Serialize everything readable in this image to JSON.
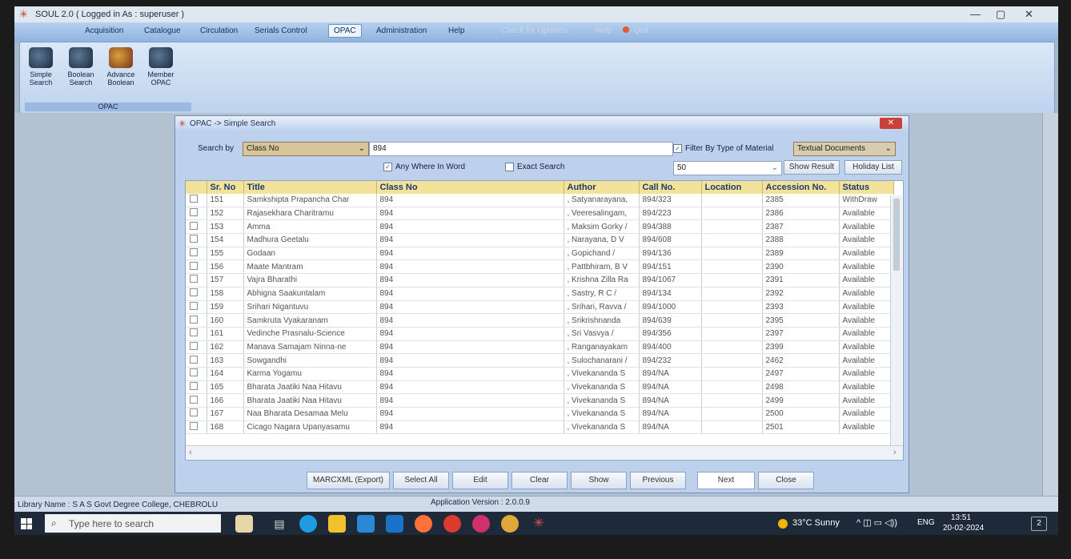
{
  "window": {
    "title": "SOUL 2.0  ( Logged in As : superuser )",
    "controls": [
      "—",
      "▢",
      "✕"
    ]
  },
  "menu": {
    "items": [
      "Acquisition",
      "Catalogue",
      "Circulation",
      "Serials Control",
      "OPAC",
      "Administration",
      "Help"
    ],
    "updates": "Check for Updates",
    "help": "Help",
    "quit": "Quit"
  },
  "ribbon": {
    "buttons": [
      {
        "label": "Simple Search",
        "icon": "magnifier-icon"
      },
      {
        "label": "Boolean Search",
        "icon": "monitor-search-icon"
      },
      {
        "label": "Advance Boolean",
        "icon": "books-icon"
      },
      {
        "label": "Member OPAC",
        "icon": "member-search-icon"
      }
    ],
    "group": "OPAC"
  },
  "dialog": {
    "title": "OPAC -> Simple Search",
    "search_by_label": "Search by",
    "search_by_value": "Class No",
    "search_value": "894",
    "any_where_label": "Any Where In Word",
    "exact_label": "Exact Search",
    "filter_label": "Filter By Type of Material",
    "material_value": "Textual Documents",
    "page_size": "50",
    "show_result": "Show Result",
    "holiday_list": "Holiday List",
    "columns": [
      "",
      "Sr. No",
      "Title",
      "Class No",
      "Author",
      "Call No.",
      "Location",
      "Accession No.",
      "Status"
    ],
    "rows": [
      [
        "151",
        "Samkshipta Prapancha Char",
        "894",
        ", Satyanarayana,",
        "894/323",
        "",
        "2385",
        "WithDraw"
      ],
      [
        "152",
        "Rajasekhara Charitramu",
        "894",
        ", Veeresalingam,",
        "894/223",
        "",
        "2386",
        "Available"
      ],
      [
        "153",
        "Amma",
        "894",
        ", Maksim Gorky /",
        "894/388",
        "",
        "2387",
        "Available"
      ],
      [
        "154",
        "Madhura Geetalu",
        "894",
        ", Narayana, D V",
        "894/608",
        "",
        "2388",
        "Available"
      ],
      [
        "155",
        "Godaan",
        "894",
        ", Gopichand /",
        "894/136",
        "",
        "2389",
        "Available"
      ],
      [
        "156",
        "Maate Mantram",
        "894",
        ", Pattbhiram, B V",
        "894/151",
        "",
        "2390",
        "Available"
      ],
      [
        "157",
        "Vajra Bharathi",
        "894",
        ", Krishna Zilla Ra",
        "894/1067",
        "",
        "2391",
        "Available"
      ],
      [
        "158",
        "Abhigna Saakuntalam",
        "894",
        ", Sastry, R C /",
        "894/134",
        "",
        "2392",
        "Available"
      ],
      [
        "159",
        "Srihari Nigantuvu",
        "894",
        ", Srihari, Ravva /",
        "894/1000",
        "",
        "2393",
        "Available"
      ],
      [
        "160",
        "Samkruta Vyakaranam",
        "894",
        ", Srikrishnanda",
        "894/639",
        "",
        "2395",
        "Available"
      ],
      [
        "161",
        "Vedinche Prasnalu-Science",
        "894",
        ", Sri Vasvya /",
        "894/356",
        "",
        "2397",
        "Available"
      ],
      [
        "162",
        "Manava Samajam Ninna-ne",
        "894",
        ", Ranganayakam",
        "894/400",
        "",
        "2399",
        "Available"
      ],
      [
        "163",
        "Sowgandhi",
        "894",
        ", Sulochanarani /",
        "894/232",
        "",
        "2462",
        "Available"
      ],
      [
        "164",
        "Karma Yogamu",
        "894",
        ", Vivekananda S",
        "894/NA",
        "",
        "2497",
        "Available"
      ],
      [
        "165",
        "Bharata Jaatiki Naa Hitavu",
        "894",
        ", Vivekananda S",
        "894/NA",
        "",
        "2498",
        "Available"
      ],
      [
        "166",
        "Bharata Jaatiki Naa Hitavu",
        "894",
        ", Vivekananda S",
        "894/NA",
        "",
        "2499",
        "Available"
      ],
      [
        "167",
        "Naa Bharata Desamaa Melu",
        "894",
        ", Vivekananda S",
        "894/NA",
        "",
        "2500",
        "Available"
      ],
      [
        "168",
        "Cicago Nagara Upanyasamu",
        "894",
        ", Vivekananda S",
        "894/NA",
        "",
        "2501",
        "Available"
      ]
    ],
    "buttons": [
      "MARCXML (Export)",
      "Select All",
      "Edit",
      "Clear",
      "Show",
      "Previous",
      "Next",
      "Close"
    ]
  },
  "status": {
    "library": "Library Name : S A S Govt Degree College, CHEBROLU",
    "version": "Application Version : 2.0.0.9"
  },
  "taskbar": {
    "search_placeholder": "Type here to search",
    "weather": "33°C  Sunny",
    "lang": "ENG",
    "time": "13:51",
    "date": "20-02-2024",
    "notifications": "2"
  },
  "colors": {
    "accent": "#f3e39a",
    "ribbon": "#bed3ee",
    "dialog": "#bdd1ec",
    "taskbar": "#1e2a3a"
  }
}
